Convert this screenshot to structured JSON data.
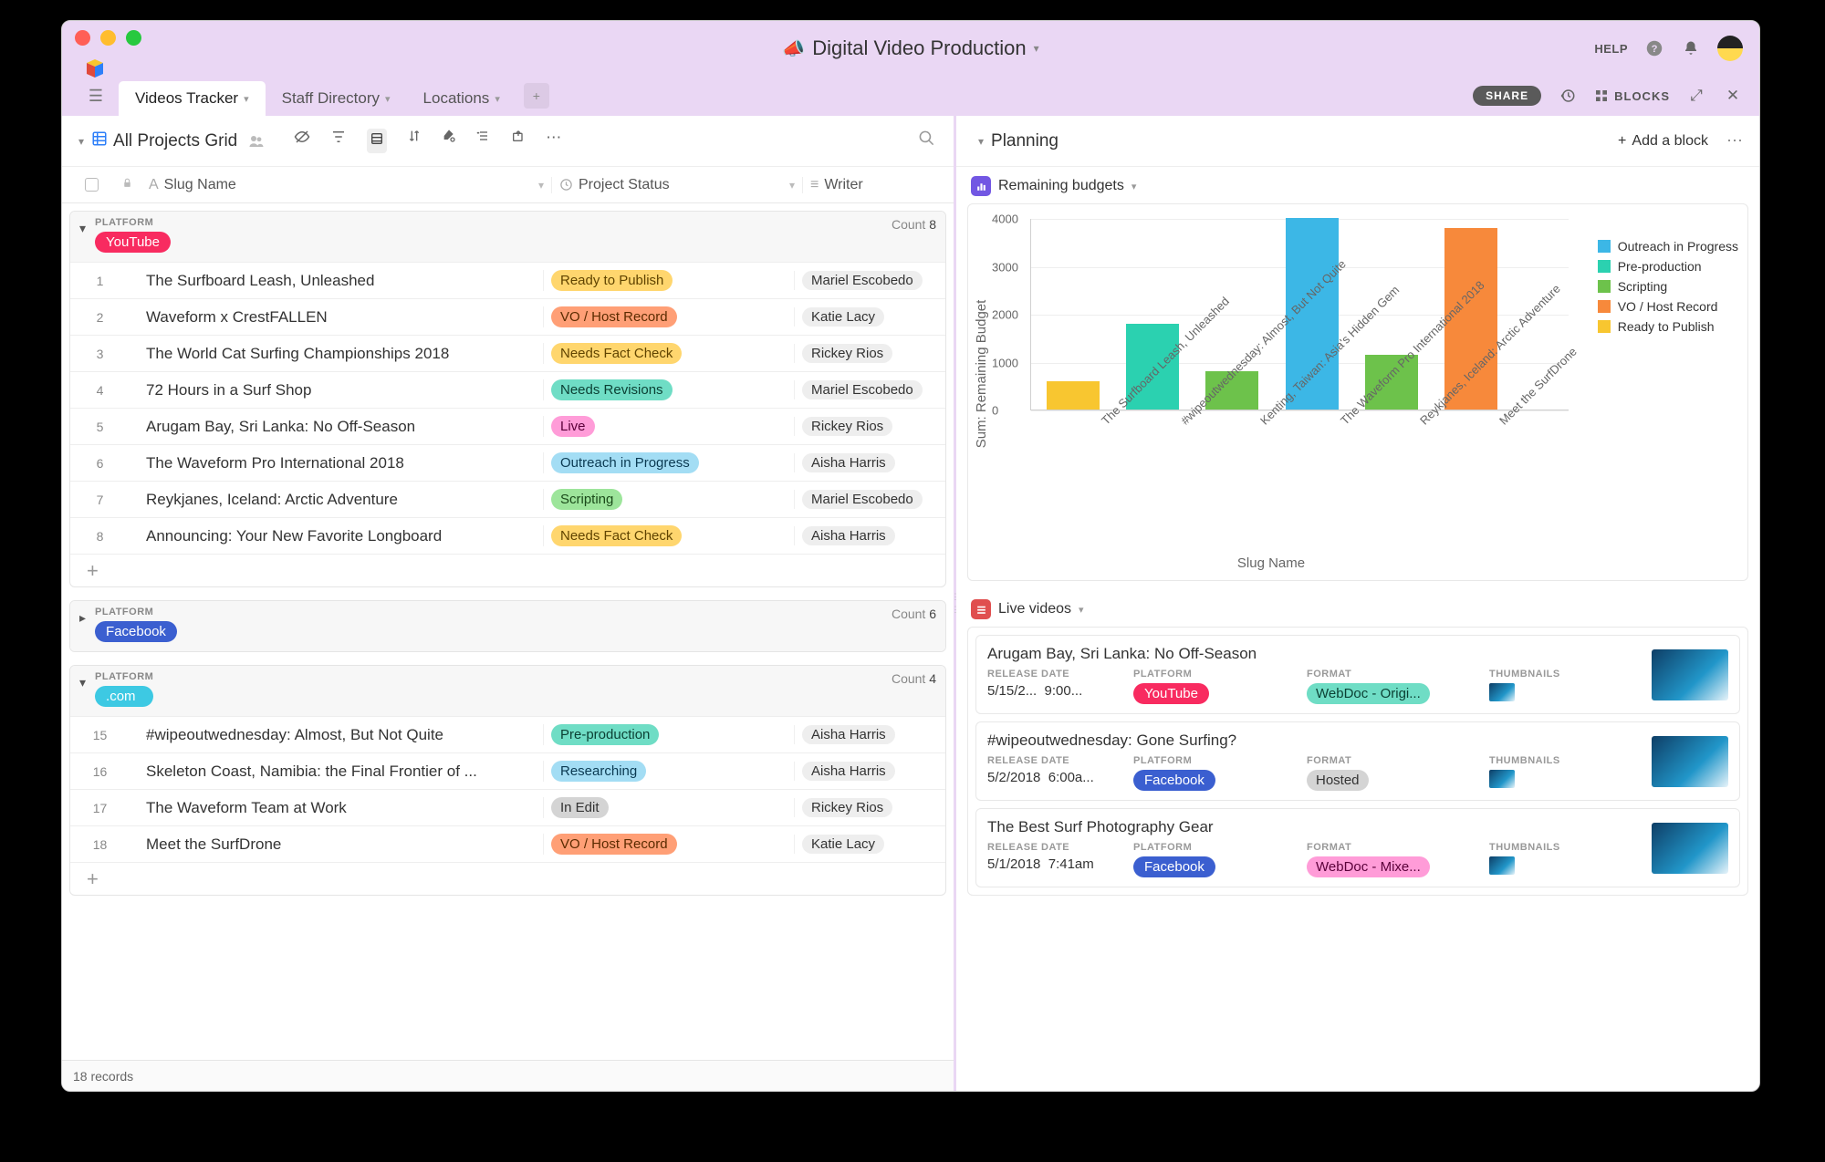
{
  "header": {
    "title": "Digital Video Production",
    "help": "HELP"
  },
  "tabs": [
    {
      "label": "Videos Tracker",
      "active": true
    },
    {
      "label": "Staff Directory",
      "active": false
    },
    {
      "label": "Locations",
      "active": false
    }
  ],
  "share_label": "SHARE",
  "blocks_label": "BLOCKS",
  "view_name": "All Projects Grid",
  "columns": {
    "slug": "Slug Name",
    "status": "Project Status",
    "writer": "Writer"
  },
  "groups": [
    {
      "key": "youtube",
      "platform_label": "PLATFORM",
      "tag": "YouTube",
      "tag_color": "#f82b60",
      "count_label": "Count",
      "count": 8,
      "open": true,
      "rows": [
        {
          "n": 1,
          "slug": "The Surfboard Leash, Unleashed",
          "status": "Ready to Publish",
          "status_bg": "#ffd66e",
          "status_fg": "#604400",
          "writer": "Mariel Escobedo"
        },
        {
          "n": 2,
          "slug": "Waveform x CrestFALLEN",
          "status": "VO / Host Record",
          "status_bg": "#ff9f76",
          "status_fg": "#5a2b00",
          "writer": "Katie Lacy"
        },
        {
          "n": 3,
          "slug": "The World Cat Surfing Championships 2018",
          "status": "Needs Fact Check",
          "status_bg": "#ffd66e",
          "status_fg": "#604400",
          "writer": "Rickey Rios"
        },
        {
          "n": 4,
          "slug": "72 Hours in a Surf Shop",
          "status": "Needs Revisions",
          "status_bg": "#6fddc5",
          "status_fg": "#0b3f33",
          "writer": "Mariel Escobedo"
        },
        {
          "n": 5,
          "slug": "Arugam Bay, Sri Lanka: No Off-Season",
          "status": "Live",
          "status_bg": "#ff9cd8",
          "status_fg": "#5a0039",
          "writer": "Rickey Rios"
        },
        {
          "n": 6,
          "slug": "The Waveform Pro International 2018",
          "status": "Outreach in Progress",
          "status_bg": "#a3ddf4",
          "status_fg": "#0b3a52",
          "writer": "Aisha Harris"
        },
        {
          "n": 7,
          "slug": "Reykjanes, Iceland: Arctic Adventure",
          "status": "Scripting",
          "status_bg": "#9de59b",
          "status_fg": "#1b4a1a",
          "writer": "Mariel Escobedo"
        },
        {
          "n": 8,
          "slug": "Announcing: Your New Favorite Longboard",
          "status": "Needs Fact Check",
          "status_bg": "#ffd66e",
          "status_fg": "#604400",
          "writer": "Aisha Harris"
        }
      ]
    },
    {
      "key": "facebook",
      "platform_label": "PLATFORM",
      "tag": "Facebook",
      "tag_color": "#3b5fd0",
      "count_label": "Count",
      "count": 6,
      "open": false
    },
    {
      "key": "dotcom",
      "platform_label": "PLATFORM",
      "tag": ".com",
      "tag_color": "#3dc9e3",
      "count_label": "Count",
      "count": 4,
      "open": true,
      "rows": [
        {
          "n": 15,
          "slug": "#wipeoutwednesday: Almost, But Not Quite",
          "status": "Pre-production",
          "status_bg": "#6fddc5",
          "status_fg": "#0b3f33",
          "writer": "Aisha Harris"
        },
        {
          "n": 16,
          "slug": "Skeleton Coast, Namibia: the Final Frontier of ...",
          "status": "Researching",
          "status_bg": "#a3ddf4",
          "status_fg": "#0b3a52",
          "writer": "Aisha Harris"
        },
        {
          "n": 17,
          "slug": "The Waveform Team at Work",
          "status": "In Edit",
          "status_bg": "#d4d4d4",
          "status_fg": "#333",
          "writer": "Rickey Rios"
        },
        {
          "n": 18,
          "slug": "Meet the SurfDrone",
          "status": "VO / Host Record",
          "status_bg": "#ff9f76",
          "status_fg": "#5a2b00",
          "writer": "Katie Lacy"
        }
      ]
    }
  ],
  "footer_records": "18 records",
  "planning": {
    "title": "Planning",
    "add": "Add a block"
  },
  "chart_block": {
    "title": "Remaining budgets",
    "icon_bg": "#7257e3"
  },
  "live_block": {
    "title": "Live videos",
    "icon_bg": "#e04f4f"
  },
  "chart_data": {
    "type": "bar",
    "title": "",
    "xlabel": "Slug Name",
    "ylabel": "Sum: Remaining Budget",
    "ylim": [
      0,
      4000
    ],
    "yticks": [
      0,
      1000,
      2000,
      3000,
      4000
    ],
    "categories": [
      "The Surfboard Leash, Unleashed",
      "#wipeoutwednesday: Almost, But Not Quite",
      "Kenting, Taiwan: Asia's Hidden Gem",
      "The Waveform Pro International 2018",
      "Reykjanes, Iceland: Arctic Adventure",
      "Meet the SurfDrone"
    ],
    "values": [
      600,
      1800,
      800,
      4000,
      1150,
      3800
    ],
    "bar_status": [
      "Ready to Publish",
      "Pre-production",
      "Scripting",
      "Outreach in Progress",
      "Scripting",
      "VO / Host Record"
    ],
    "status_colors": {
      "Outreach in Progress": "#3cb7e6",
      "Pre-production": "#2bd1b0",
      "Scripting": "#6dc24b",
      "VO / Host Record": "#f7893b",
      "Ready to Publish": "#f8c630"
    },
    "legend": [
      "Outreach in Progress",
      "Pre-production",
      "Scripting",
      "VO / Host Record",
      "Ready to Publish"
    ]
  },
  "live_videos": [
    {
      "title": "Arugam Bay, Sri Lanka: No Off-Season",
      "labels": {
        "date": "RELEASE DATE",
        "platform": "PLATFORM",
        "format": "FORMAT",
        "thumb": "THUMBNAILS"
      },
      "date": "5/15/2...",
      "time": "9:00...",
      "platform": "YouTube",
      "platform_color": "#f82b60",
      "format": "WebDoc - Origi...",
      "format_bg": "#6fddc5",
      "format_fg": "#0b3f33"
    },
    {
      "title": "#wipeoutwednesday: Gone Surfing?",
      "labels": {
        "date": "RELEASE DATE",
        "platform": "PLATFORM",
        "format": "FORMAT",
        "thumb": "THUMBNAILS"
      },
      "date": "5/2/2018",
      "time": "6:00a...",
      "platform": "Facebook",
      "platform_color": "#3b5fd0",
      "format": "Hosted",
      "format_bg": "#d4d4d4",
      "format_fg": "#333"
    },
    {
      "title": "The Best Surf Photography Gear",
      "labels": {
        "date": "RELEASE DATE",
        "platform": "PLATFORM",
        "format": "FORMAT",
        "thumb": "THUMBNAILS"
      },
      "date": "5/1/2018",
      "time": "7:41am",
      "platform": "Facebook",
      "platform_color": "#3b5fd0",
      "format": "WebDoc - Mixe...",
      "format_bg": "#ff9cd8",
      "format_fg": "#5a0039"
    }
  ]
}
